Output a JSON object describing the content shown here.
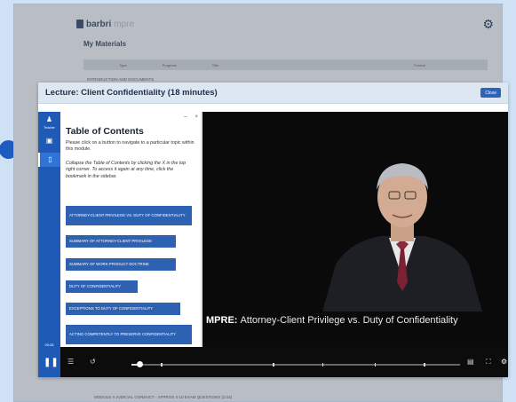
{
  "background": {
    "brand": "barbri",
    "brand_sub": "mpre",
    "page_title": "My Materials",
    "table_headers": [
      "Type",
      "Progress",
      "Title",
      "Format"
    ],
    "row1": "INTRODUCTION AND DOCUMENTS",
    "footer_row": "MODULE II JUDICIAL CONDUCT · APPROX 4-10 EXAM QUESTIONS (2:44)"
  },
  "modal": {
    "title": "Lecture: Client Confidentiality (18 minutes)",
    "close_label": "Close"
  },
  "rail": {
    "user_label": "Teacher",
    "time_elapsed": "00:28",
    "time_total": "18:57"
  },
  "toc": {
    "minimize": "–",
    "close": "×",
    "title": "Table of Contents",
    "intro": "Please click on a button to navigate to a particular topic within this module.",
    "hint": "Collapse the Table of Contents by clicking the X in the top right corner. To access it again at any time, click the bookmark in the sidebar.",
    "items": [
      "ATTORNEY-CLIENT PRIVILEGE VS. DUTY OF CONFIDENTIALITY",
      "SUMMARY OF ATTORNEY-CLIENT PRIVILEGE",
      "SUMMARY OF WORK-PRODUCT DOCTRINE",
      "DUTY OF CONFIDENTIALITY",
      "EXCEPTIONS TO DUTY OF CONFIDENTIALITY",
      "ACTING COMPETENTLY TO PRESERVE CONFIDENTIALITY"
    ]
  },
  "video": {
    "caption_bold": "MPRE:",
    "caption_rest": "Attorney-Client Privilege vs. Duty of Confidentiality",
    "progress": 0.025,
    "chapter_marks": [
      0.09,
      0.43,
      0.58,
      0.74,
      0.89
    ]
  },
  "icons": {
    "settings": "gear-icon",
    "pause": "pause-icon",
    "toc_toggle": "list-icon",
    "rewind": "rewind-icon",
    "captions": "captions-icon",
    "fullscreen": "fullscreen-icon"
  },
  "colors": {
    "accent": "#1f5bb6",
    "toc_button": "#2d62b2",
    "page_bg": "#cfe2f5"
  }
}
